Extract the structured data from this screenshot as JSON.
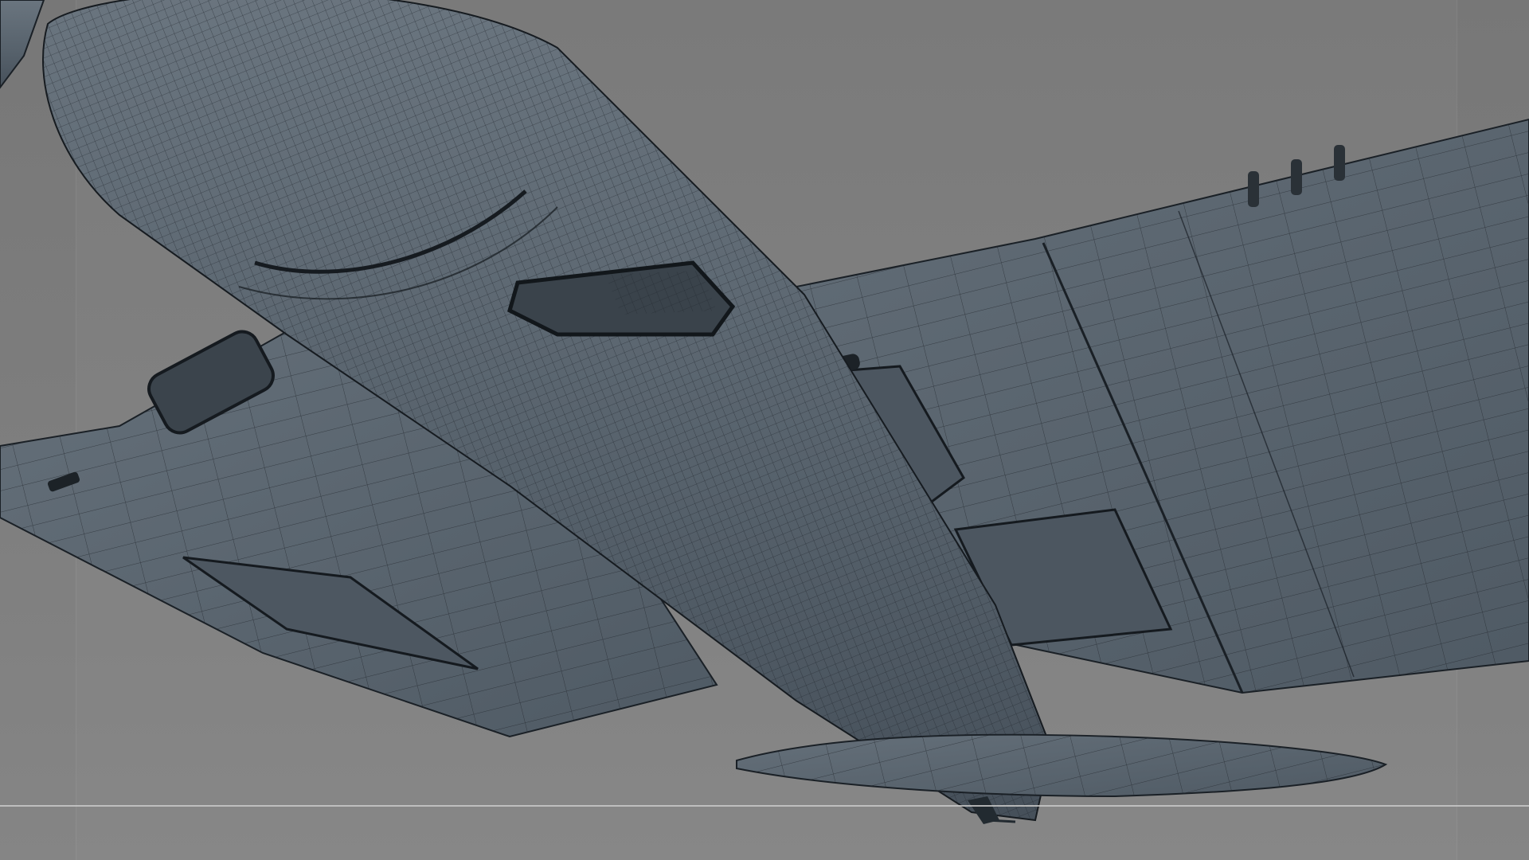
{
  "viewport": {
    "shading_mode": "wireframe-on-shaded",
    "background_color": "#7b7b7b",
    "mesh_color": "#5a6570",
    "wire_color": "#1f252b",
    "ground_line_color": "#c8c8c8"
  },
  "model": {
    "icons": [
      "engine-cowling-icon",
      "wing-icon",
      "tail-fin-icon",
      "tail-wheel-icon"
    ]
  }
}
